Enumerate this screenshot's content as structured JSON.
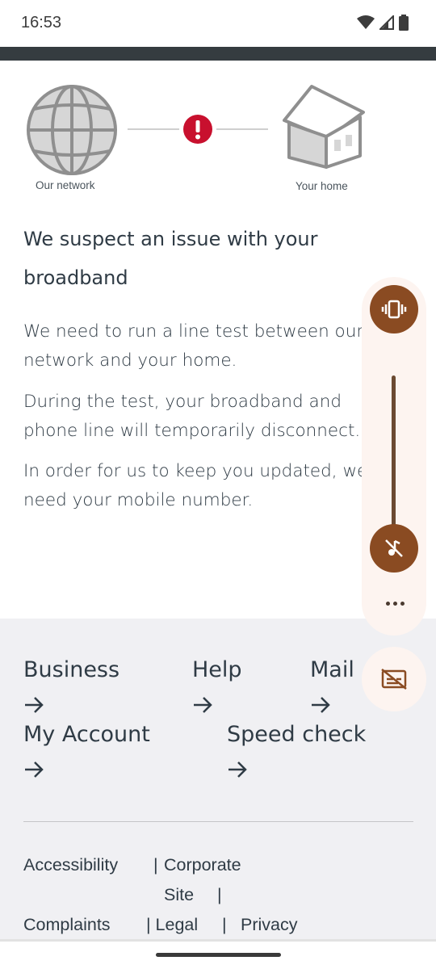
{
  "status_bar": {
    "time": "16:53"
  },
  "diagram": {
    "left_caption": "Our network",
    "right_caption": "Your home",
    "alert_icon": "exclamation-alert-icon",
    "colors": {
      "alert": "#c8102e",
      "icon_stroke": "#8f8f8f"
    }
  },
  "main": {
    "headline_line1": "We suspect an issue with your",
    "headline_line2": "broadband",
    "paragraphs": [
      [
        "We need to run a line test between our",
        "network and your home."
      ],
      [
        "During the test, your broadband and",
        "phone line will temporarily disconnect."
      ],
      [
        "In order for us to keep you updated, we",
        "need your mobile number."
      ]
    ]
  },
  "footer": {
    "links": [
      "Business",
      "Help",
      "Mail",
      "My Account",
      "Speed check"
    ],
    "small_links": {
      "accessibility": "Accessibility",
      "sep1": "|",
      "corporate": "Corporate",
      "site": "Site",
      "sep2": "|",
      "complaints": "Complaints",
      "sep3": "| Legal",
      "sep4": "|",
      "privacy": "Privacy"
    }
  },
  "volume_panel": {
    "icons": [
      "vibrate-icon",
      "ring-muted-icon",
      "more-options-icon",
      "live-caption-off-icon"
    ],
    "accent": "#8a4b22"
  }
}
